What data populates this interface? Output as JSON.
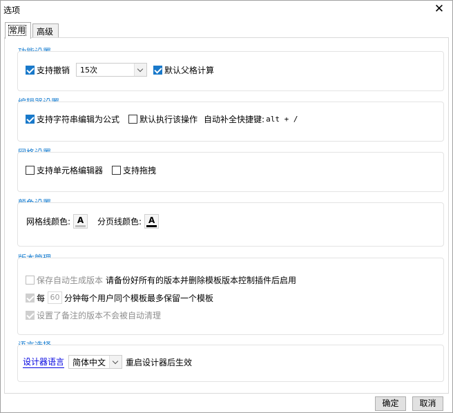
{
  "window": {
    "title": "选项",
    "close_symbol": "✕"
  },
  "tabs": [
    {
      "label": "常用",
      "active": true
    },
    {
      "label": "高级",
      "active": false
    }
  ],
  "sections": {
    "features": {
      "title": "功能设置",
      "undo_label": "支持撤销",
      "undo_checked": true,
      "undo_steps": "15次",
      "default_format_label": "默认父格计算",
      "default_format_checked": true
    },
    "editor": {
      "title": "编辑器设置",
      "string_formula_label": "支持字符串编辑为公式",
      "string_formula_checked": true,
      "default_exec_label": "默认执行该操作",
      "default_exec_checked": false,
      "autocomplete_label": "自动补全快捷键:",
      "autocomplete_shortcut": "alt + /"
    },
    "grid": {
      "title": "网格设置",
      "cell_editor_label": "支持单元格编辑器",
      "cell_editor_checked": false,
      "drag_label": "支持拖拽",
      "drag_checked": false
    },
    "color": {
      "title": "颜色设置",
      "gridline_label": "网格线颜色:",
      "pageline_label": "分页线颜色:",
      "button_letter": "A",
      "gridline_color": "#c0c0c0",
      "pageline_color": "#000000"
    },
    "version": {
      "title": "版本管理",
      "auto_version_label": "保存自动生成版本",
      "auto_version_note": "请备份好所有的版本并删除模板版本控制插件后启用",
      "every_label": "每",
      "minutes_value": "60",
      "minutes_suffix": "分钟每个用户同个模板最多保留一个模板",
      "noted_label": "设置了备注的版本不会被自动清理"
    },
    "language": {
      "title": "语言选择",
      "designer_language_link": "设计器语言",
      "selected_language": "简体中文",
      "restart_note": "重启设计器后生效"
    }
  },
  "footer": {
    "ok_label": "确定",
    "cancel_label": "取消"
  },
  "colors": {
    "accent": "#1a7fd1",
    "checkbox_checked": "#1979ca",
    "link": "#0000e0"
  }
}
